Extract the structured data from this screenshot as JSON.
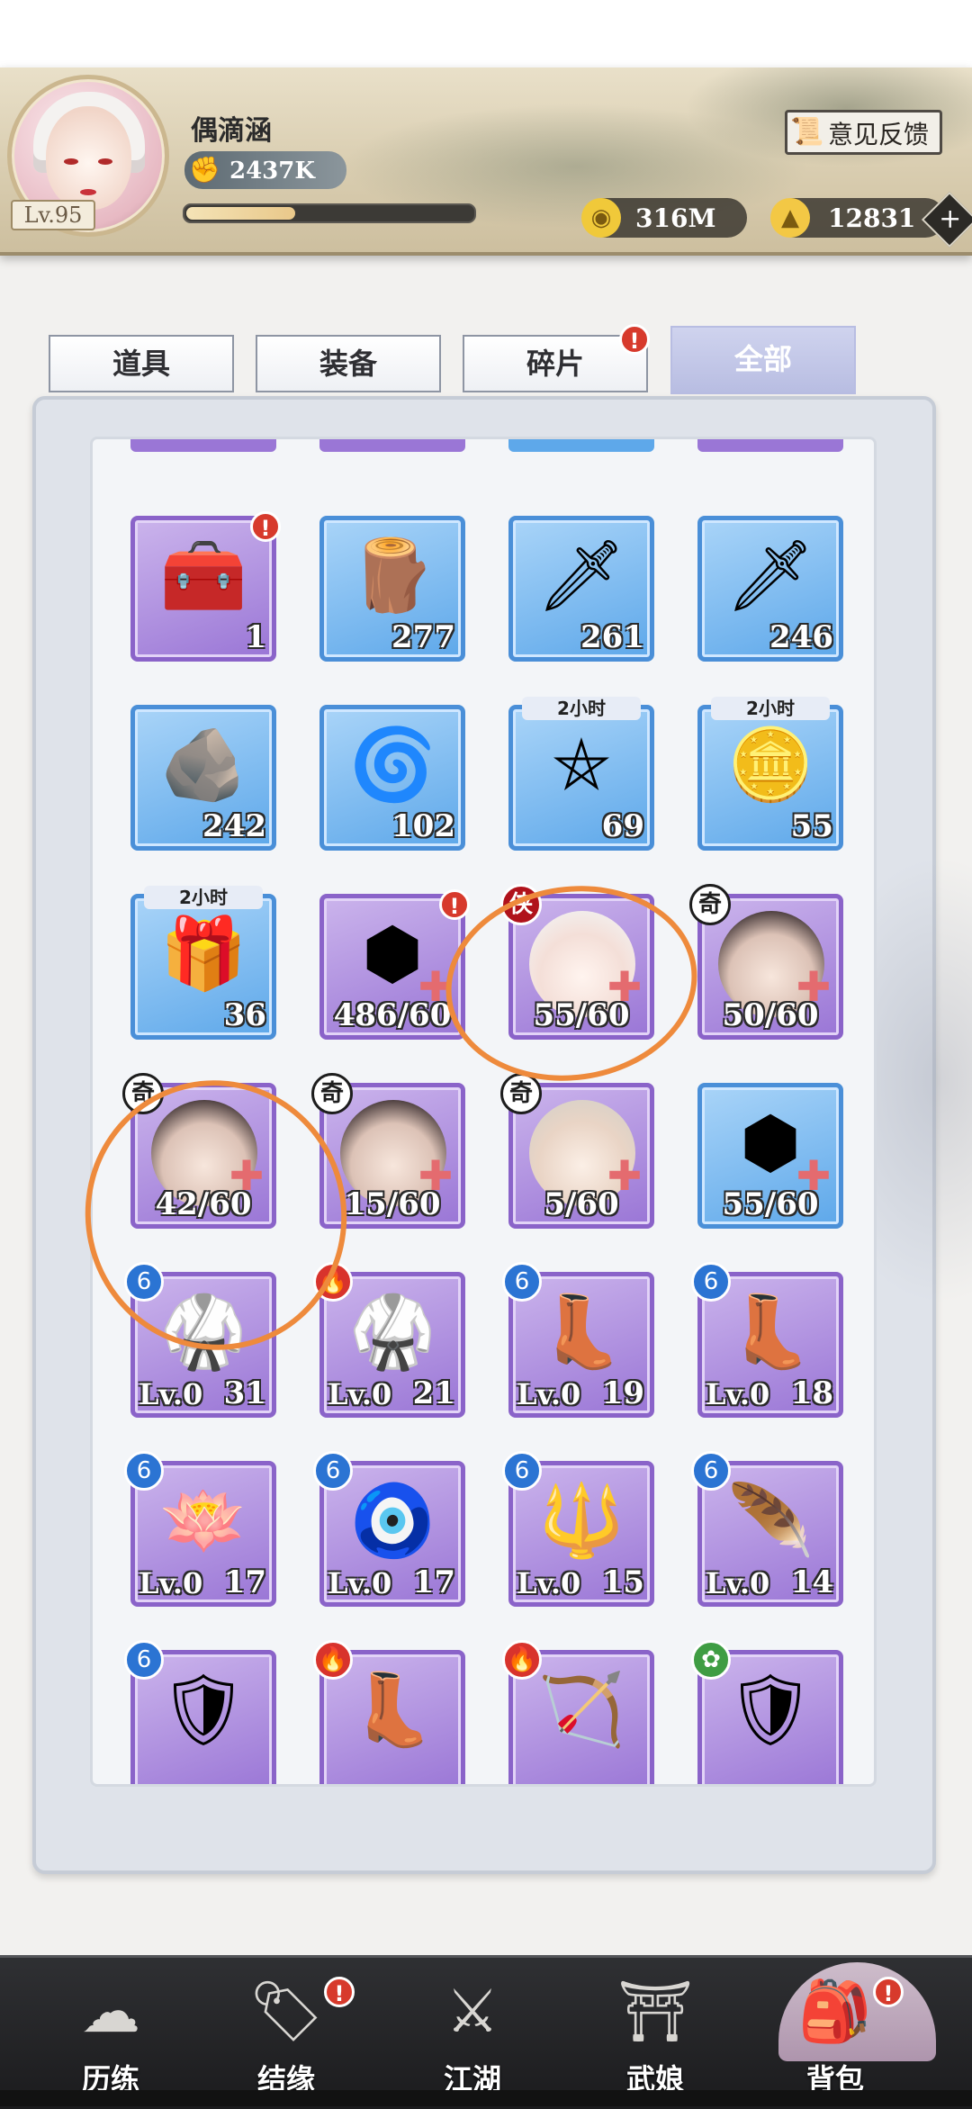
{
  "player": {
    "name": "偶滴涵",
    "level": "Lv.95",
    "power": "2437K",
    "exp_fraction": 0.38
  },
  "header": {
    "feedback_label": "意见反馈",
    "currencies": [
      {
        "icon": "gold-coin-icon",
        "value": "316M"
      },
      {
        "icon": "gold-ingot-icon",
        "value": "12831"
      }
    ],
    "plus_symbol": "+"
  },
  "tabs": [
    {
      "label": "道具",
      "active": false,
      "alert": false
    },
    {
      "label": "装备",
      "active": false,
      "alert": false
    },
    {
      "label": "碎片",
      "active": false,
      "alert": true
    },
    {
      "label": "全部",
      "active": true,
      "alert": false
    }
  ],
  "alert_symbol": "!",
  "items": [
    {
      "kind": "treasure-chest",
      "rarity": "purple",
      "count": "1",
      "alert": true,
      "glyph": "🧰"
    },
    {
      "kind": "wood-log",
      "rarity": "blue",
      "count": "277",
      "glyph": "🪵"
    },
    {
      "kind": "throwing-knife",
      "rarity": "blue",
      "count": "261",
      "glyph": "🗡"
    },
    {
      "kind": "sword-blade",
      "rarity": "blue",
      "count": "246",
      "glyph": "🗡"
    },
    {
      "kind": "ore-rocks",
      "rarity": "blue",
      "count": "242",
      "glyph": "🪨"
    },
    {
      "kind": "spiral-stone",
      "rarity": "blue",
      "count": "102",
      "glyph": "🌀"
    },
    {
      "kind": "pentagram-seal",
      "rarity": "blue",
      "count": "69",
      "timer": "2小时",
      "glyph": "⛤"
    },
    {
      "kind": "gold-coin",
      "rarity": "blue",
      "count": "55",
      "timer": "2小时",
      "glyph": "🪙"
    },
    {
      "kind": "gold-box",
      "rarity": "blue",
      "count": "36",
      "timer": "2小时",
      "glyph": "🎁"
    },
    {
      "kind": "purple-gem-fragment",
      "rarity": "purple",
      "count": "486/60",
      "alert": true,
      "glyph": "⬢"
    },
    {
      "kind": "hero-fragment",
      "rarity": "purple",
      "count": "55/60",
      "role": "侠",
      "role_color": "red",
      "portrait": "white"
    },
    {
      "kind": "hero-fragment",
      "rarity": "purple",
      "count": "50/60",
      "role": "奇",
      "portrait": "dark"
    },
    {
      "kind": "hero-fragment",
      "rarity": "purple",
      "count": "42/60",
      "role": "奇",
      "portrait": "dark"
    },
    {
      "kind": "hero-fragment",
      "rarity": "purple",
      "count": "15/60",
      "role": "奇",
      "portrait": "dark"
    },
    {
      "kind": "hero-fragment",
      "rarity": "purple",
      "count": "5/60",
      "role": "奇",
      "portrait": "light"
    },
    {
      "kind": "blue-gem-fragment",
      "rarity": "blue",
      "count": "55/60",
      "glyph": "⬢"
    },
    {
      "kind": "robe-armor",
      "rarity": "purple",
      "level": "Lv.0",
      "count": "31",
      "element": "water",
      "glyph": "🥋"
    },
    {
      "kind": "robe-armor",
      "rarity": "purple",
      "level": "Lv.0",
      "count": "21",
      "element": "fire",
      "glyph": "🥋"
    },
    {
      "kind": "boots",
      "rarity": "purple",
      "level": "Lv.0",
      "count": "19",
      "element": "water",
      "glyph": "👢"
    },
    {
      "kind": "boots",
      "rarity": "purple",
      "level": "Lv.0",
      "count": "18",
      "element": "water",
      "glyph": "👢"
    },
    {
      "kind": "lotus-fan",
      "rarity": "purple",
      "level": "Lv.0",
      "count": "17",
      "element": "water",
      "glyph": "🪷"
    },
    {
      "kind": "jade-pendant",
      "rarity": "purple",
      "level": "Lv.0",
      "count": "17",
      "element": "water",
      "glyph": "🧿"
    },
    {
      "kind": "spear-weapon",
      "rarity": "purple",
      "level": "Lv.0",
      "count": "15",
      "element": "water",
      "glyph": "🔱"
    },
    {
      "kind": "feather-fan",
      "rarity": "purple",
      "level": "Lv.0",
      "count": "14",
      "element": "water",
      "glyph": "🪶"
    },
    {
      "kind": "chest-armor",
      "rarity": "purple",
      "element": "water",
      "glyph": "🛡"
    },
    {
      "kind": "boots",
      "rarity": "purple",
      "element": "fire",
      "glyph": "👢"
    },
    {
      "kind": "bow-weapon",
      "rarity": "purple",
      "element": "fire",
      "glyph": "🏹"
    },
    {
      "kind": "chest-armor",
      "rarity": "purple",
      "element": "wood",
      "glyph": "🛡"
    }
  ],
  "element_symbols": {
    "water": "6",
    "fire": "🔥",
    "wood": "✿"
  },
  "nav": [
    {
      "label": "历练",
      "icon": "cloud-icon",
      "glyph": "☁",
      "alert": false,
      "active": false
    },
    {
      "label": "结缘",
      "icon": "plaque-icon",
      "glyph": "🏷",
      "alert": true,
      "active": false
    },
    {
      "label": "江湖",
      "icon": "crossed-swords-icon",
      "glyph": "⚔",
      "alert": false,
      "active": false
    },
    {
      "label": "武娘",
      "icon": "bamboo-hat-icon",
      "glyph": "⛩",
      "alert": false,
      "active": false
    },
    {
      "label": "背包",
      "icon": "backpack-icon",
      "glyph": "🎒",
      "alert": true,
      "active": true
    }
  ],
  "colors": {
    "accent_orange": "#ee8a3c",
    "alert_red": "#d73a2c",
    "blue_frame": "#4a8fd8",
    "purple_frame": "#8a63c9"
  }
}
